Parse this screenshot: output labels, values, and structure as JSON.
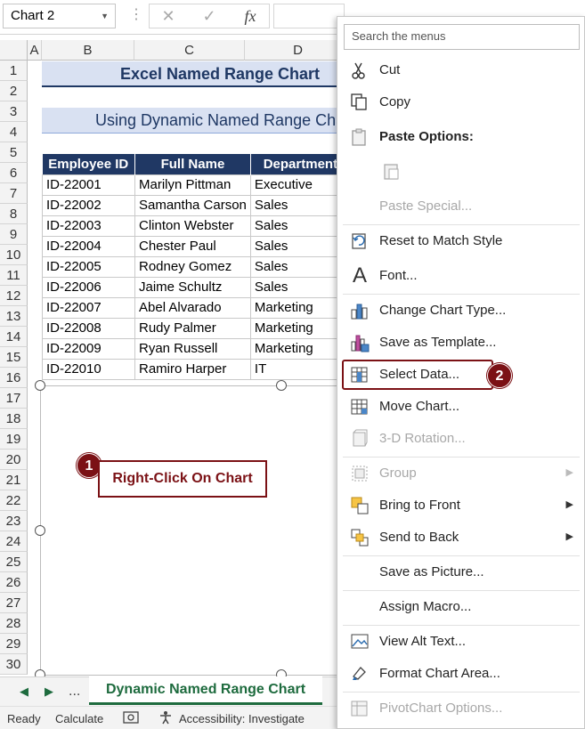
{
  "formula_bar": {
    "name_box": "Chart 2",
    "cancel_icon": "✕",
    "enter_icon": "✓",
    "fx_label": "fx"
  },
  "columns": [
    "A",
    "B",
    "C",
    "D"
  ],
  "rows": [
    "1",
    "2",
    "3",
    "4",
    "5",
    "6",
    "7",
    "8",
    "9",
    "10",
    "11",
    "12",
    "13",
    "14",
    "15",
    "16",
    "17",
    "18",
    "19",
    "20",
    "21",
    "22",
    "23",
    "24",
    "25",
    "26",
    "27",
    "28",
    "29",
    "30"
  ],
  "sheet": {
    "title": "Excel Named Range Chart",
    "subtitle": "Using Dynamic Named Range Chart",
    "table": {
      "headers": [
        "Employee ID",
        "Full Name",
        "Department"
      ],
      "rows": [
        [
          "ID-22001",
          "Marilyn Pittman",
          "Executive"
        ],
        [
          "ID-22002",
          "Samantha Carson",
          "Sales"
        ],
        [
          "ID-22003",
          "Clinton Webster",
          "Sales"
        ],
        [
          "ID-22004",
          "Chester Paul",
          "Sales"
        ],
        [
          "ID-22005",
          "Rodney Gomez",
          "Sales"
        ],
        [
          "ID-22006",
          "Jaime Schultz",
          "Sales"
        ],
        [
          "ID-22007",
          "Abel Alvarado",
          "Marketing"
        ],
        [
          "ID-22008",
          "Rudy Palmer",
          "Marketing"
        ],
        [
          "ID-22009",
          "Ryan Russell",
          "Marketing"
        ],
        [
          "ID-22010",
          "Ramiro Harper",
          "IT"
        ]
      ]
    }
  },
  "annotations": {
    "step1_number": "1",
    "step1_text": "Right-Click On Chart",
    "step2_number": "2"
  },
  "tabs": {
    "prev": "◀",
    "next": "▶",
    "more": "...",
    "active": "Dynamic Named Range Chart"
  },
  "status_bar": {
    "ready": "Ready",
    "calculate": "Calculate",
    "accessibility": "Accessibility: Investigate"
  },
  "context_menu": {
    "search_placeholder": "Search the menus",
    "items": [
      {
        "label": "Cut",
        "icon": "scissors-icon",
        "disabled": false
      },
      {
        "label": "Copy",
        "icon": "copy-icon",
        "disabled": false
      },
      {
        "label": "Paste Options:",
        "icon": "paste-icon",
        "disabled": false
      },
      {
        "label": "Paste Special...",
        "icon": "",
        "disabled": true
      },
      {
        "label": "Reset to Match Style",
        "icon": "reset-icon",
        "disabled": false
      },
      {
        "label": "Font...",
        "icon": "font-icon",
        "disabled": false
      },
      {
        "label": "Change Chart Type...",
        "icon": "chart-type-icon",
        "disabled": false
      },
      {
        "label": "Save as Template...",
        "icon": "template-icon",
        "disabled": false
      },
      {
        "label": "Select Data...",
        "icon": "select-data-icon",
        "disabled": false
      },
      {
        "label": "Move Chart...",
        "icon": "move-chart-icon",
        "disabled": false
      },
      {
        "label": "3-D Rotation...",
        "icon": "rotation-icon",
        "disabled": true
      },
      {
        "label": "Group",
        "icon": "group-icon",
        "disabled": true
      },
      {
        "label": "Bring to Front",
        "icon": "bring-front-icon",
        "disabled": false
      },
      {
        "label": "Send to Back",
        "icon": "send-back-icon",
        "disabled": false
      },
      {
        "label": "Save as Picture...",
        "icon": "",
        "disabled": false
      },
      {
        "label": "Assign Macro...",
        "icon": "",
        "disabled": false
      },
      {
        "label": "View Alt Text...",
        "icon": "alt-text-icon",
        "disabled": false
      },
      {
        "label": "Format Chart Area...",
        "icon": "format-icon",
        "disabled": false
      },
      {
        "label": "PivotChart Options...",
        "icon": "pivot-icon",
        "disabled": true
      }
    ]
  },
  "colors": {
    "header_fill": "#203864",
    "title_fill": "#d9e1f2",
    "accent_red": "#7b1115",
    "excel_green": "#1e6b3e"
  }
}
